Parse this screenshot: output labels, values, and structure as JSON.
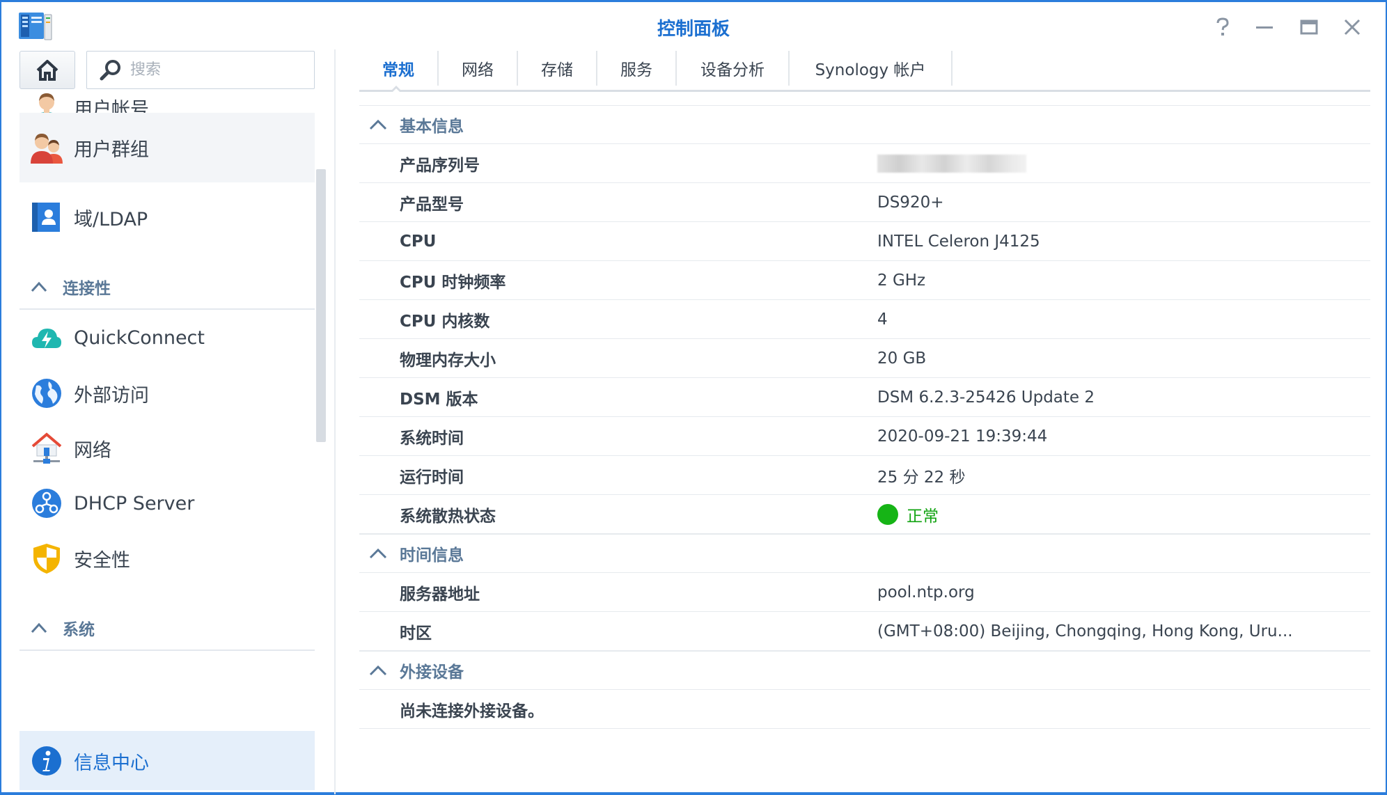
{
  "window": {
    "title": "控制面板",
    "accent_color": "#2b7ddc",
    "buttons": [
      "help-icon",
      "minimize-icon",
      "maximize-icon",
      "close-icon"
    ]
  },
  "search": {
    "placeholder": "搜索",
    "value": ""
  },
  "sidebar": {
    "items": [
      {
        "label": "用户帐号",
        "icon": "user-icon"
      },
      {
        "label": "用户群组",
        "icon": "user-group-icon"
      },
      {
        "label": "域/LDAP",
        "icon": "directory-icon"
      },
      {
        "section": "连接性"
      },
      {
        "label": "QuickConnect",
        "icon": "quickconnect-cloud-icon"
      },
      {
        "label": "外部访问",
        "icon": "globe-icon"
      },
      {
        "label": "网络",
        "icon": "network-house-icon"
      },
      {
        "label": "DHCP Server",
        "icon": "dhcp-icon"
      },
      {
        "label": "安全性",
        "icon": "shield-icon"
      },
      {
        "section": "系统"
      },
      {
        "label": "信息中心",
        "icon": "info-icon",
        "active": true
      }
    ]
  },
  "tabs": [
    {
      "label": "常规",
      "active": true
    },
    {
      "label": "网络"
    },
    {
      "label": "存储"
    },
    {
      "label": "服务"
    },
    {
      "label": "设备分析"
    },
    {
      "label": "Synology 帐户"
    }
  ],
  "info": {
    "basic": {
      "title": "基本信息",
      "rows": [
        {
          "key": "产品序列号",
          "value": ""
        },
        {
          "key": "产品型号",
          "value": "DS920+"
        },
        {
          "key": "CPU",
          "value": "INTEL Celeron J4125"
        },
        {
          "key": "CPU 时钟频率",
          "value": "2 GHz"
        },
        {
          "key": "CPU 内核数",
          "value": "4"
        },
        {
          "key": "物理内存大小",
          "value": "20 GB"
        },
        {
          "key": "DSM 版本",
          "value": "DSM 6.2.3-25426 Update 2"
        },
        {
          "key": "系统时间",
          "value": "2020-09-21 19:39:44"
        },
        {
          "key": "运行时间",
          "value": "25 分 22 秒"
        },
        {
          "key": "系统散热状态",
          "value": "正常",
          "status_color": "#16b416"
        }
      ]
    },
    "time": {
      "title": "时间信息",
      "rows": [
        {
          "key": "服务器地址",
          "value": "pool.ntp.org"
        },
        {
          "key": "时区",
          "value": "(GMT+08:00) Beijing, Chongqing, Hong Kong, Uru..."
        }
      ]
    },
    "external": {
      "title": "外接设备",
      "empty_text": "尚未连接外接设备。"
    }
  }
}
